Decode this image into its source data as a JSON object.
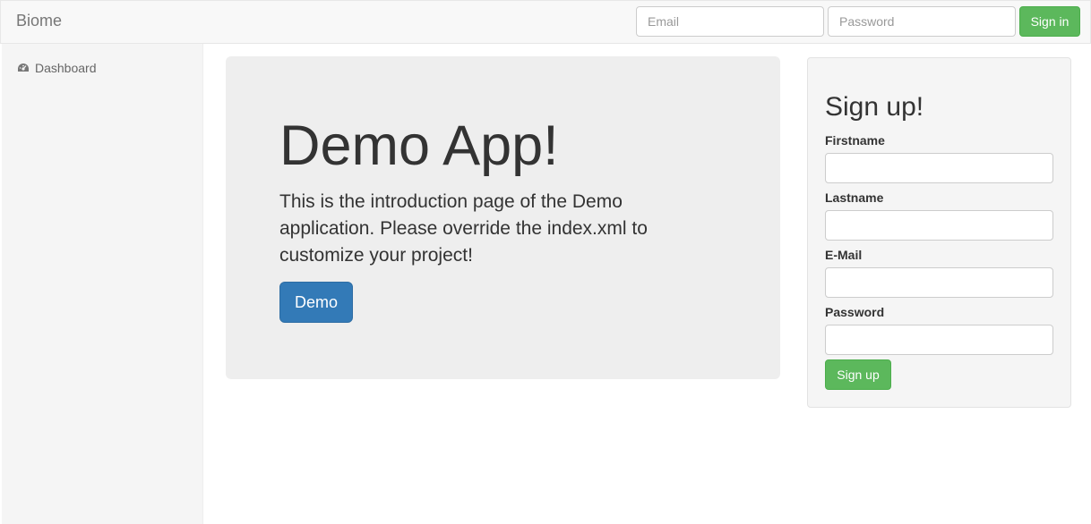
{
  "navbar": {
    "brand": "Biome",
    "email_placeholder": "Email",
    "password_placeholder": "Password",
    "signin_label": "Sign in"
  },
  "sidebar": {
    "items": [
      {
        "label": "Dashboard",
        "icon": "dashboard-icon"
      }
    ]
  },
  "jumbotron": {
    "title": "Demo App!",
    "text": "This is the introduction page of the Demo application. Please override the index.xml to customize your project!",
    "button_label": "Demo"
  },
  "signup": {
    "title": "Sign up!",
    "fields": [
      {
        "label": "Firstname",
        "value": ""
      },
      {
        "label": "Lastname",
        "value": ""
      },
      {
        "label": "E-Mail",
        "value": ""
      },
      {
        "label": "Password",
        "value": ""
      }
    ],
    "button_label": "Sign up"
  },
  "colors": {
    "success": "#5cb85c",
    "primary": "#337ab7",
    "jumbotron_bg": "#eeeeee",
    "sidebar_bg": "#f5f5f5"
  }
}
